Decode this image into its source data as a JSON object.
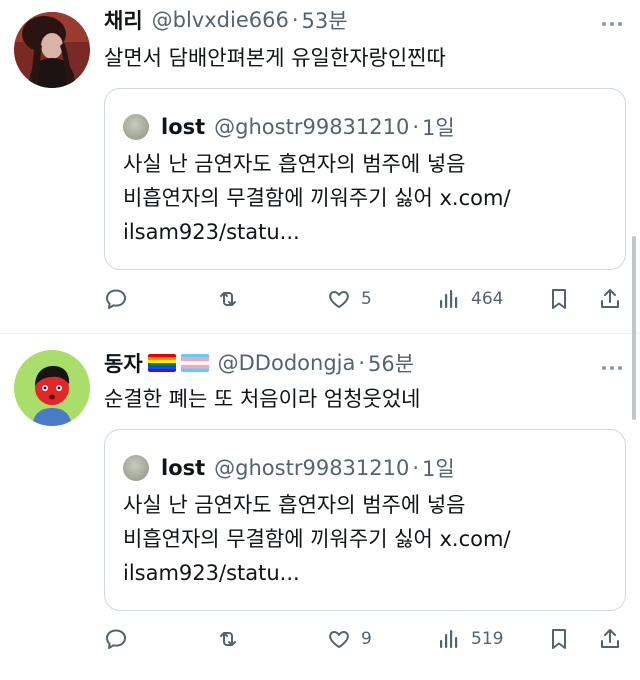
{
  "tweets": [
    {
      "name": "채리",
      "handle": "@blvxdie666",
      "separator": "·",
      "time": "53분",
      "text": "살면서 담배안펴본게 유일한자랑인찐따",
      "quote": {
        "name": "lost",
        "handle": "@ghostr99831210",
        "separator": "·",
        "time": "1일",
        "lines": [
          "사실 난 금연자도 흡연자의 범주에 넣음",
          "비흡연자의 무결함에 끼워주기 싫어 x.com/",
          "ilsam923/statu..."
        ]
      },
      "likes": "5",
      "views": "464"
    },
    {
      "name": "동자",
      "handle": "@DDodongja",
      "separator": "·",
      "time": "56분",
      "text": "순결한 폐는 또 처음이라 엄청웃었네",
      "flags": [
        "rainbow-flag",
        "transgender-flag"
      ],
      "quote": {
        "name": "lost",
        "handle": "@ghostr99831210",
        "separator": "·",
        "time": "1일",
        "lines": [
          "사실 난 금연자도 흡연자의 범주에 넣음",
          "비흡연자의 무결함에 끼워주기 싫어 x.com/",
          "ilsam923/statu..."
        ]
      },
      "likes": "9",
      "views": "519"
    }
  ],
  "icons": [
    "more-icon",
    "reply-icon",
    "retweet-icon",
    "like-icon",
    "views-icon",
    "bookmark-icon",
    "share-icon"
  ],
  "colors": {
    "text": "#0f1419",
    "secondary": "#536471",
    "border": "#cfd9de"
  }
}
